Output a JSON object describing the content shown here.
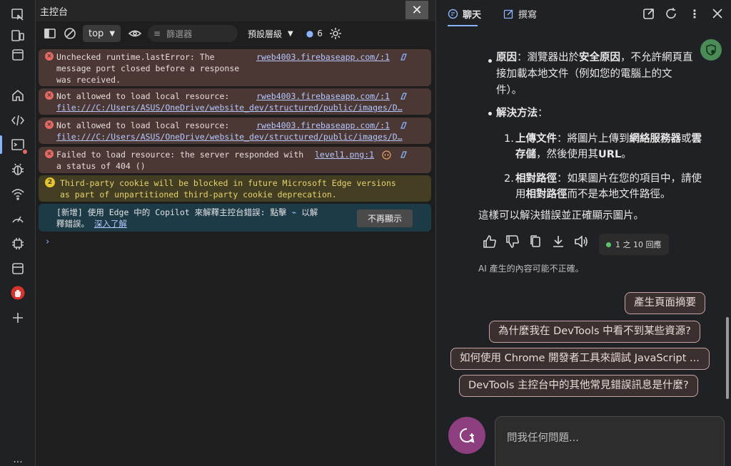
{
  "activity_bar": {
    "items": [
      {
        "name": "inspect"
      },
      {
        "name": "device-emulation"
      },
      {
        "name": "window"
      },
      {
        "name": "welcome"
      },
      {
        "name": "elements"
      },
      {
        "name": "console"
      },
      {
        "name": "issues"
      },
      {
        "name": "network"
      },
      {
        "name": "performance"
      },
      {
        "name": "memory"
      },
      {
        "name": "application"
      },
      {
        "name": "adblock"
      },
      {
        "name": "add-tool"
      }
    ],
    "more_label": "..."
  },
  "console": {
    "title": "主控台",
    "close_label": "✕",
    "toolbar": {
      "context": "top",
      "filter_placeholder": "篩選器",
      "levels_label": "預設層級",
      "issues_count": "6"
    },
    "messages": [
      {
        "type": "error",
        "lines": [
          "Unchecked runtime.lastError: The",
          "message port closed before a response",
          "was received."
        ],
        "source": "rweb4003.firebaseapp.com/:1"
      },
      {
        "type": "error",
        "lines": [
          "Not allowed to load local resource:"
        ],
        "link": "file:///C:/Users/ASUS/OneDrive/website_dev/structured/public/images/D…",
        "source": "rweb4003.firebaseapp.com/:1"
      },
      {
        "type": "error",
        "lines": [
          "Not allowed to load local resource:"
        ],
        "link": "file:///C:/Users/ASUS/OneDrive/website_dev/structured/public/images/D…",
        "source": "rweb4003.firebaseapp.com/:1"
      },
      {
        "type": "error",
        "lines": [
          "Failed to load resource: the server responded with",
          "a status of 404 ()"
        ],
        "source": "level1.png:1"
      },
      {
        "type": "warning",
        "count": "2",
        "lines": [
          "Third-party cookie will be blocked in future Microsoft Edge versions",
          "as part of unpartitioned third-party cookie deprecation."
        ]
      }
    ],
    "copilot_tip": {
      "line1_a": "[新增] 使用 Edge 中的 Copilot 來解釋主控台錯誤: 點擊",
      "line1_b": "以解",
      "line2": "釋錯誤。",
      "learn_more": "深入了解",
      "dont_show": "不再顯示"
    },
    "prompt": "›"
  },
  "copilot": {
    "tabs": {
      "chat": "聊天",
      "compose": "撰寫"
    },
    "answer": {
      "cause_label": "原因",
      "cause_text_1": "：瀏覽器出於",
      "cause_bold": "安全原因",
      "cause_text_2": "，不允許網頁直",
      "cause_line2": "接加載本地文件（例如您的電腦上的文",
      "cause_line3": "件）。",
      "solution_label": "解決方法",
      "solution_colon": "：",
      "s1_label": "上傳文件",
      "s1_text_1": "：將圖片上傳到",
      "s1_bold_1": "網絡服務器",
      "s1_text_2": "或",
      "s1_bold_2": "雲",
      "s1_line2_bold": "存儲",
      "s1_line2_text": "，然後使用其",
      "s1_line2_bold2": "URL",
      "s1_line2_end": "。",
      "s2_label": "相對路徑",
      "s2_text": "：如果圖片在您的項目中，請使",
      "s2_line2_a": "用",
      "s2_line2_bold": "相對路徑",
      "s2_line2_b": "而不是本地文件路徑。",
      "summary": "這樣可以解決錯誤並正確顯示圖片。"
    },
    "turn_count": "1 之 10 回應",
    "disclaimer": "AI 產生的內容可能不正確。",
    "suggestions": [
      "產生頁面摘要",
      "為什麼我在 DevTools 中看不到某些資源?",
      "如何使用 Chrome 開發者工具來調試 JavaScript ...",
      "DevTools 主控台中的其他常見錯誤訊息是什麼?"
    ],
    "ask_placeholder": "問我任何問題..."
  },
  "colors": {
    "accent": "#8ab4f8",
    "error_bg": "#4b3835",
    "warning_bg": "#433d24",
    "info_bg": "#1d3a47",
    "new_topic": "#8d3f7f"
  }
}
